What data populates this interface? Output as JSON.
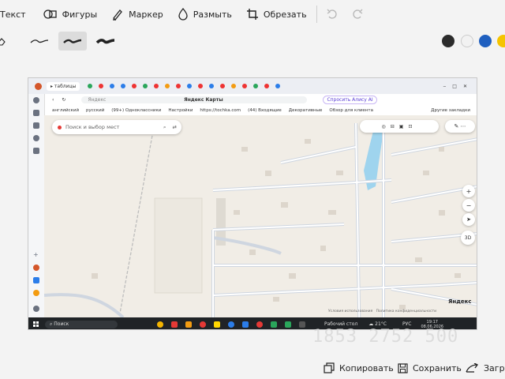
{
  "toolbar": {
    "text_label": "Текст",
    "shapes_label": "Фигуры",
    "marker_label": "Маркер",
    "blur_label": "Размыть",
    "crop_label": "Обрезать"
  },
  "colors": {
    "swatches": [
      "#2b2b2b",
      "#f2f2f2",
      "#1f5fbf",
      "#f5c400"
    ]
  },
  "bottom": {
    "copy_label": "Копировать",
    "save_label": "Сохранить",
    "share_label": "Загру"
  },
  "watermark": "1853 2752 500",
  "screenshot": {
    "tab_label": "таблицы",
    "addr_site": "Яндекс",
    "addr_title": "Яндекс Карты",
    "ask_alice": "Спросить Алису AI",
    "bookmarks": [
      "английский",
      "русский",
      "(99+) Одноклассники",
      "Настройки",
      "https://tochka.com",
      "(44) Входящие",
      "Декоративные",
      "Обзор для клиента",
      "Другие закладки"
    ],
    "search_placeholder": "Поиск и выбор мест",
    "map_brand": "Яндекс",
    "map_footer": "Условия использования   Политика конфиденциальности",
    "taskbar_search": "Поиск",
    "taskbar_desktop": "Рабочий стол",
    "taskbar_temp": "21°C",
    "taskbar_lang": "РУС",
    "taskbar_time": "19:17",
    "taskbar_date": "08.06.2026",
    "map_ctrl_3d": "3D"
  }
}
